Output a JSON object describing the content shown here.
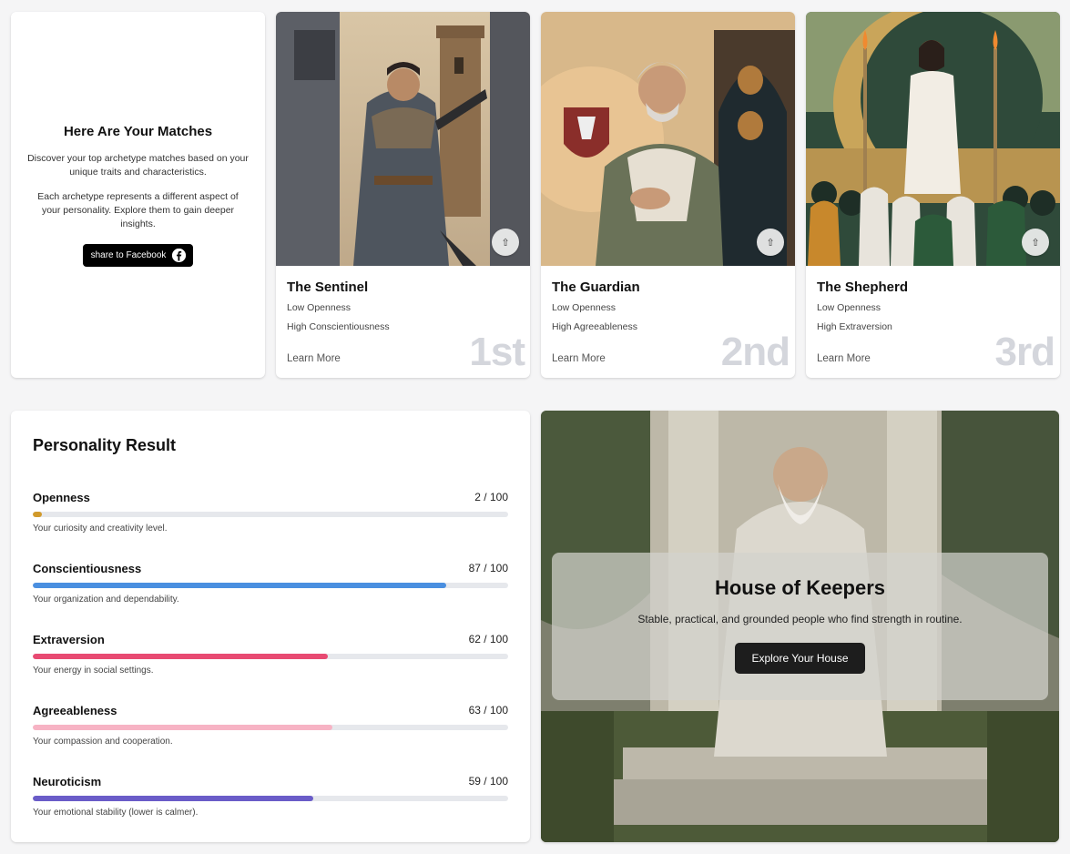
{
  "intro": {
    "title": "Here Are Your Matches",
    "desc1": "Discover your top archetype matches based on your unique traits and characteristics.",
    "desc2": "Each archetype represents a different aspect of your personality. Explore them to gain deeper insights.",
    "share_label": "share to Facebook",
    "share_icon": "facebook-icon"
  },
  "archetypes": [
    {
      "name": "The Sentinel",
      "trait1": "Low Openness",
      "trait2": "High Conscientiousness",
      "learn": "Learn More",
      "rank": "1st",
      "share_icon": "share-icon"
    },
    {
      "name": "The Guardian",
      "trait1": "Low Openness",
      "trait2": "High Agreeableness",
      "learn": "Learn More",
      "rank": "2nd",
      "share_icon": "share-icon"
    },
    {
      "name": "The Shepherd",
      "trait1": "Low Openness",
      "trait2": "High Extraversion",
      "learn": "Learn More",
      "rank": "3rd",
      "share_icon": "share-icon"
    }
  ],
  "personality": {
    "title": "Personality Result",
    "traits": [
      {
        "label": "Openness",
        "score": "2 / 100",
        "value": 2,
        "color": "#d19a2b",
        "desc": "Your curiosity and creativity level."
      },
      {
        "label": "Conscientiousness",
        "score": "87 / 100",
        "value": 87,
        "color": "#4a8fe0",
        "desc": "Your organization and dependability."
      },
      {
        "label": "Extraversion",
        "score": "62 / 100",
        "value": 62,
        "color": "#e84a72",
        "desc": "Your energy in social settings."
      },
      {
        "label": "Agreeableness",
        "score": "63 / 100",
        "value": 63,
        "color": "#f7b3c4",
        "desc": "Your compassion and cooperation."
      },
      {
        "label": "Neuroticism",
        "score": "59 / 100",
        "value": 59,
        "color": "#6a5cc8",
        "desc": "Your emotional stability (lower is calmer)."
      }
    ]
  },
  "house": {
    "title": "House of Keepers",
    "desc": "Stable, practical, and grounded people who find strength in routine.",
    "button": "Explore Your House"
  }
}
